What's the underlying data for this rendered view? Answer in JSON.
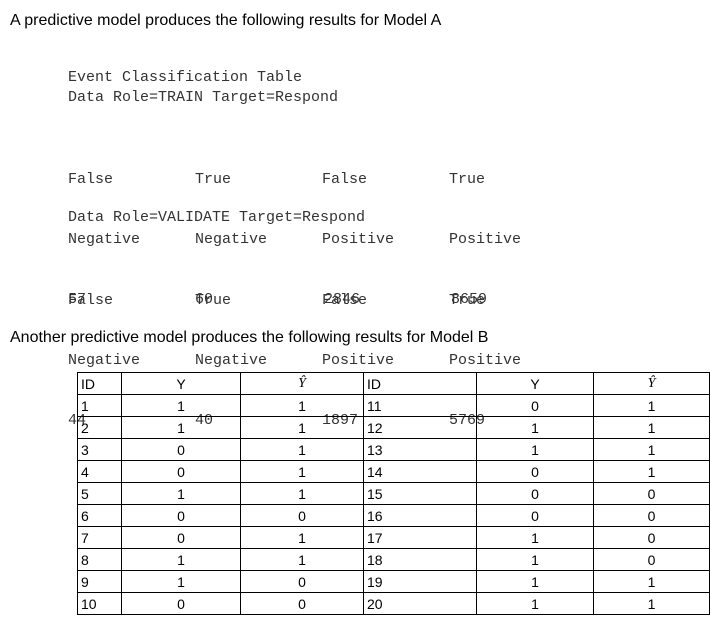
{
  "model_a": {
    "heading": "A predictive model produces the following results for Model A",
    "table_title": "Event Classification Table",
    "train": {
      "role_line": "Data Role=TRAIN Target=Respond",
      "columns": [
        {
          "line1": "False",
          "line2": "Negative",
          "value": "57"
        },
        {
          "line1": "True",
          "line2": "Negative",
          "value": "60"
        },
        {
          "line1": "False",
          "line2": "Positive",
          "value": "2846"
        },
        {
          "line1": "True",
          "line2": "Positive",
          "value": "8659"
        }
      ]
    },
    "validate": {
      "role_line": "Data Role=VALIDATE Target=Respond",
      "columns": [
        {
          "line1": "False",
          "line2": "Negative",
          "value": "44"
        },
        {
          "line1": "True",
          "line2": "Negative",
          "value": "40"
        },
        {
          "line1": "False",
          "line2": "Positive",
          "value": "1897"
        },
        {
          "line1": "True",
          "line2": "Positive",
          "value": "5769"
        }
      ]
    }
  },
  "model_b": {
    "heading": "Another predictive model produces the following results for Model B",
    "headers": [
      "ID",
      "Y",
      "Ŷ",
      "ID",
      "Y",
      "Ŷ"
    ],
    "rows": [
      [
        "1",
        "1",
        "1",
        "11",
        "0",
        "1"
      ],
      [
        "2",
        "1",
        "1",
        "12",
        "1",
        "1"
      ],
      [
        "3",
        "0",
        "1",
        "13",
        "1",
        "1"
      ],
      [
        "4",
        "0",
        "1",
        "14",
        "0",
        "1"
      ],
      [
        "5",
        "1",
        "1",
        "15",
        "0",
        "0"
      ],
      [
        "6",
        "0",
        "0",
        "16",
        "0",
        "0"
      ],
      [
        "7",
        "0",
        "1",
        "17",
        "1",
        "0"
      ],
      [
        "8",
        "1",
        "1",
        "18",
        "1",
        "0"
      ],
      [
        "9",
        "1",
        "0",
        "19",
        "1",
        "1"
      ],
      [
        "10",
        "0",
        "0",
        "20",
        "1",
        "1"
      ]
    ]
  }
}
